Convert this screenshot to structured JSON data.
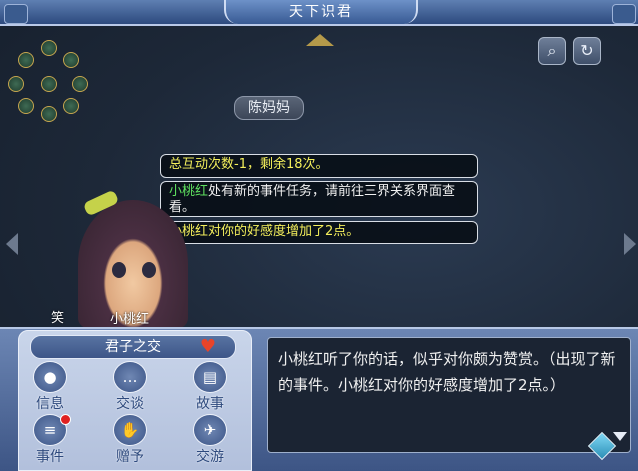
{
  "window": {
    "title": "天下识君"
  },
  "scene": {
    "npc_name": "陈妈妈",
    "compass_icon": "bagua-compass-icon"
  },
  "messages": [
    {
      "text": "总互动次数-1，剩余18次。",
      "color": "#f4ef5c"
    },
    {
      "name": "小桃红",
      "text": "处有新的事件任务，请前往三界关系界面查看。",
      "name_color": "#5fe05f"
    },
    {
      "text": "小桃红对你的好感度增加了2点。",
      "color": "#f4ef5c"
    }
  ],
  "character": {
    "name": "小桃红",
    "expression": "笑"
  },
  "relationship": {
    "label": "君子之交",
    "icon": "heart-icon"
  },
  "actions": [
    {
      "label": "信息",
      "icon": "person-icon"
    },
    {
      "label": "交谈",
      "icon": "chat-bubble-icon"
    },
    {
      "label": "故事",
      "icon": "book-icon"
    },
    {
      "label": "事件",
      "icon": "list-icon",
      "badge": true
    },
    {
      "label": "赠予",
      "icon": "gift-hand-icon"
    },
    {
      "label": "交游",
      "icon": "travel-icon"
    }
  ],
  "dialogue": {
    "text": "小桃红听了你的话，似乎对你颇为赞赏。（出现了新的事件。小桃红对你的好感度增加了2点。）"
  },
  "colors": {
    "accent_blue": "#3d5585",
    "highlight_yellow": "#f4ef5c",
    "highlight_green": "#5fe05f",
    "badge_red": "#e02121"
  }
}
